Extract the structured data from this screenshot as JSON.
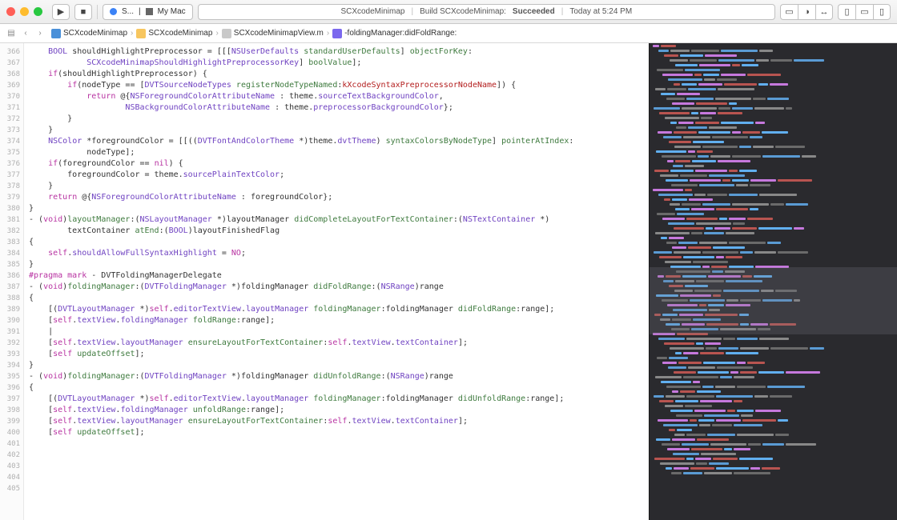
{
  "toolbar": {
    "scheme": "S...",
    "destination": "My Mac",
    "status_project": "SCXcodeMinimap",
    "status_action": "Build SCXcodeMinimap:",
    "status_result": "Succeeded",
    "status_time": "Today at 5:24 PM"
  },
  "jumpbar": {
    "segments": [
      {
        "icon": "proj",
        "label": "SCXcodeMinimap"
      },
      {
        "icon": "folder",
        "label": "SCXcodeMinimap"
      },
      {
        "icon": "file",
        "label": "SCXcodeMinimapView.m"
      },
      {
        "icon": "method",
        "label": "-foldingManager:didFoldRange:"
      }
    ]
  },
  "gutter": {
    "start": 366,
    "count": 40
  },
  "code_lines": [
    {
      "indent": 1,
      "tokens": [
        [
          "type",
          "BOOL"
        ],
        [
          "",
          " shouldHighlightPreprocessor = [[["
        ],
        [
          "type",
          "NSUserDefaults"
        ],
        [
          "",
          " "
        ],
        [
          "sel",
          "standardUserDefaults"
        ],
        [
          "",
          "] "
        ],
        [
          "sel",
          "objectForKey"
        ],
        [
          "",
          ":"
        ]
      ]
    },
    {
      "indent": 3,
      "tokens": [
        [
          "type",
          "SCXcodeMinimapShouldHighlightPreprocessorKey"
        ],
        [
          "",
          "] "
        ],
        [
          "sel",
          "boolValue"
        ],
        [
          "",
          "];"
        ]
      ]
    },
    {
      "indent": 1,
      "tokens": [
        [
          "kw",
          "if"
        ],
        [
          "",
          "(shouldHighlightPreprocessor) {"
        ]
      ]
    },
    {
      "indent": 2,
      "tokens": [
        [
          "kw",
          "if"
        ],
        [
          "",
          "(nodeType == ["
        ],
        [
          "type",
          "DVTSourceNodeTypes"
        ],
        [
          "",
          " "
        ],
        [
          "sel",
          "registerNodeTypeNamed"
        ],
        [
          "",
          ":"
        ],
        [
          "lit",
          "kXcodeSyntaxPreprocessorNodeName"
        ],
        [
          "",
          "]) {"
        ]
      ]
    },
    {
      "indent": 3,
      "tokens": [
        [
          "kw",
          "return"
        ],
        [
          "",
          " @{"
        ],
        [
          "type",
          "NSForegroundColorAttributeName"
        ],
        [
          "",
          " : theme."
        ],
        [
          "prop",
          "sourceTextBackgroundColor"
        ],
        [
          "",
          ","
        ]
      ]
    },
    {
      "indent": 5,
      "tokens": [
        [
          "type",
          "NSBackgroundColorAttributeName"
        ],
        [
          "",
          " : theme."
        ],
        [
          "prop",
          "preprocessorBackgroundColor"
        ],
        [
          "",
          "};"
        ]
      ]
    },
    {
      "indent": 2,
      "tokens": [
        [
          "",
          "}"
        ]
      ]
    },
    {
      "indent": 1,
      "tokens": [
        [
          "",
          "}"
        ]
      ]
    },
    {
      "indent": 0,
      "tokens": [
        [
          "",
          ""
        ]
      ]
    },
    {
      "indent": 1,
      "tokens": [
        [
          "type",
          "NSColor"
        ],
        [
          "",
          " *foregroundColor = [[(("
        ],
        [
          "type",
          "DVTFontAndColorTheme"
        ],
        [
          "",
          " *)theme."
        ],
        [
          "prop",
          "dvtTheme"
        ],
        [
          "",
          ") "
        ],
        [
          "sel",
          "syntaxColorsByNodeType"
        ],
        [
          "",
          "] "
        ],
        [
          "sel",
          "pointerAtIndex"
        ],
        [
          "",
          ":"
        ]
      ]
    },
    {
      "indent": 3,
      "tokens": [
        [
          "",
          "nodeType];"
        ]
      ]
    },
    {
      "indent": 1,
      "tokens": [
        [
          "kw",
          "if"
        ],
        [
          "",
          "(foregroundColor == "
        ],
        [
          "kw",
          "nil"
        ],
        [
          "",
          ") {"
        ]
      ]
    },
    {
      "indent": 2,
      "tokens": [
        [
          "",
          "foregroundColor = theme."
        ],
        [
          "prop",
          "sourcePlainTextColor"
        ],
        [
          "",
          ";"
        ]
      ]
    },
    {
      "indent": 1,
      "tokens": [
        [
          "",
          "}"
        ]
      ]
    },
    {
      "indent": 0,
      "tokens": [
        [
          "",
          ""
        ]
      ]
    },
    {
      "indent": 1,
      "tokens": [
        [
          "kw",
          "return"
        ],
        [
          "",
          " @{"
        ],
        [
          "type",
          "NSForegroundColorAttributeName"
        ],
        [
          "",
          " : foregroundColor};"
        ]
      ]
    },
    {
      "indent": 0,
      "tokens": [
        [
          "",
          "}"
        ]
      ]
    },
    {
      "indent": 0,
      "tokens": [
        [
          "",
          ""
        ]
      ]
    },
    {
      "indent": 0,
      "tokens": [
        [
          "",
          "- ("
        ],
        [
          "kw",
          "void"
        ],
        [
          "",
          ")"
        ],
        [
          "sel",
          "layoutManager"
        ],
        [
          "",
          ":("
        ],
        [
          "type",
          "NSLayoutManager"
        ],
        [
          "",
          " *)layoutManager "
        ],
        [
          "sel",
          "didCompleteLayoutForTextContainer"
        ],
        [
          "",
          ":("
        ],
        [
          "type",
          "NSTextContainer"
        ],
        [
          "",
          " *)"
        ]
      ]
    },
    {
      "indent": 2,
      "tokens": [
        [
          "",
          "textContainer "
        ],
        [
          "sel",
          "atEnd"
        ],
        [
          "",
          ":("
        ],
        [
          "type",
          "BOOL"
        ],
        [
          "",
          ")layoutFinishedFlag"
        ]
      ]
    },
    {
      "indent": 0,
      "tokens": [
        [
          "",
          "{"
        ]
      ]
    },
    {
      "indent": 1,
      "tokens": [
        [
          "kw",
          "self"
        ],
        [
          "",
          "."
        ],
        [
          "prop",
          "shouldAllowFullSyntaxHighlight"
        ],
        [
          "",
          " = "
        ],
        [
          "kw",
          "NO"
        ],
        [
          "",
          ";"
        ]
      ]
    },
    {
      "indent": 0,
      "tokens": [
        [
          "",
          "}"
        ]
      ]
    },
    {
      "indent": 0,
      "tokens": [
        [
          "",
          ""
        ]
      ]
    },
    {
      "indent": 0,
      "tokens": [
        [
          "kw",
          "#pragma mark"
        ],
        [
          "",
          " - DVTFoldingManagerDelegate"
        ]
      ]
    },
    {
      "indent": 0,
      "tokens": [
        [
          "",
          ""
        ]
      ]
    },
    {
      "indent": 0,
      "tokens": [
        [
          "",
          "- ("
        ],
        [
          "kw",
          "void"
        ],
        [
          "",
          ")"
        ],
        [
          "sel",
          "foldingManager"
        ],
        [
          "",
          ":("
        ],
        [
          "type",
          "DVTFoldingManager"
        ],
        [
          "",
          " *)foldingManager "
        ],
        [
          "sel",
          "didFoldRange"
        ],
        [
          "",
          ":("
        ],
        [
          "type",
          "NSRange"
        ],
        [
          "",
          ")range"
        ]
      ]
    },
    {
      "indent": 0,
      "tokens": [
        [
          "",
          "{"
        ]
      ]
    },
    {
      "indent": 1,
      "tokens": [
        [
          "",
          "[("
        ],
        [
          "type",
          "DVTLayoutManager"
        ],
        [
          "",
          " *)"
        ],
        [
          "kw",
          "self"
        ],
        [
          "",
          "."
        ],
        [
          "prop",
          "editorTextView"
        ],
        [
          "",
          "."
        ],
        [
          "prop",
          "layoutManager"
        ],
        [
          "",
          " "
        ],
        [
          "sel",
          "foldingManager"
        ],
        [
          "",
          ":foldingManager "
        ],
        [
          "sel",
          "didFoldRange"
        ],
        [
          "",
          ":range];"
        ]
      ]
    },
    {
      "indent": 0,
      "tokens": [
        [
          "",
          ""
        ]
      ]
    },
    {
      "indent": 1,
      "tokens": [
        [
          "",
          "["
        ],
        [
          "kw",
          "self"
        ],
        [
          "",
          "."
        ],
        [
          "prop",
          "textView"
        ],
        [
          "",
          "."
        ],
        [
          "prop",
          "foldingManager"
        ],
        [
          "",
          " "
        ],
        [
          "sel",
          "foldRange"
        ],
        [
          "",
          ":range];"
        ]
      ]
    },
    {
      "indent": 1,
      "tokens": [
        [
          "",
          "|"
        ]
      ]
    },
    {
      "indent": 1,
      "tokens": [
        [
          "",
          "["
        ],
        [
          "kw",
          "self"
        ],
        [
          "",
          "."
        ],
        [
          "prop",
          "textView"
        ],
        [
          "",
          "."
        ],
        [
          "prop",
          "layoutManager"
        ],
        [
          "",
          " "
        ],
        [
          "sel",
          "ensureLayoutForTextContainer"
        ],
        [
          "",
          ":"
        ],
        [
          "kw",
          "self"
        ],
        [
          "",
          "."
        ],
        [
          "prop",
          "textView"
        ],
        [
          "",
          "."
        ],
        [
          "prop",
          "textContainer"
        ],
        [
          "",
          "];"
        ]
      ]
    },
    {
      "indent": 1,
      "tokens": [
        [
          "",
          "["
        ],
        [
          "kw",
          "self"
        ],
        [
          "",
          " "
        ],
        [
          "sel",
          "updateOffset"
        ],
        [
          "",
          "];"
        ]
      ]
    },
    {
      "indent": 0,
      "tokens": [
        [
          "",
          "}"
        ]
      ]
    },
    {
      "indent": 0,
      "tokens": [
        [
          "",
          ""
        ]
      ]
    },
    {
      "indent": 0,
      "tokens": [
        [
          "",
          "- ("
        ],
        [
          "kw",
          "void"
        ],
        [
          "",
          ")"
        ],
        [
          "sel",
          "foldingManager"
        ],
        [
          "",
          ":("
        ],
        [
          "type",
          "DVTFoldingManager"
        ],
        [
          "",
          " *)foldingManager "
        ],
        [
          "sel",
          "didUnfoldRange"
        ],
        [
          "",
          ":("
        ],
        [
          "type",
          "NSRange"
        ],
        [
          "",
          ")range"
        ]
      ]
    },
    {
      "indent": 0,
      "tokens": [
        [
          "",
          "{"
        ]
      ]
    },
    {
      "indent": 1,
      "tokens": [
        [
          "",
          "[("
        ],
        [
          "type",
          "DVTLayoutManager"
        ],
        [
          "",
          " *)"
        ],
        [
          "kw",
          "self"
        ],
        [
          "",
          "."
        ],
        [
          "prop",
          "editorTextView"
        ],
        [
          "",
          "."
        ],
        [
          "prop",
          "layoutManager"
        ],
        [
          "",
          " "
        ],
        [
          "sel",
          "foldingManager"
        ],
        [
          "",
          ":foldingManager "
        ],
        [
          "sel",
          "didUnfoldRange"
        ],
        [
          "",
          ":range];"
        ]
      ]
    },
    {
      "indent": 0,
      "tokens": [
        [
          "",
          ""
        ]
      ]
    },
    {
      "indent": 1,
      "tokens": [
        [
          "",
          "["
        ],
        [
          "kw",
          "self"
        ],
        [
          "",
          "."
        ],
        [
          "prop",
          "textView"
        ],
        [
          "",
          "."
        ],
        [
          "prop",
          "foldingManager"
        ],
        [
          "",
          " "
        ],
        [
          "sel",
          "unfoldRange"
        ],
        [
          "",
          ":range];"
        ]
      ]
    },
    {
      "indent": 0,
      "tokens": [
        [
          "",
          ""
        ]
      ]
    },
    {
      "indent": 1,
      "tokens": [
        [
          "",
          "["
        ],
        [
          "kw",
          "self"
        ],
        [
          "",
          "."
        ],
        [
          "prop",
          "textView"
        ],
        [
          "",
          "."
        ],
        [
          "prop",
          "layoutManager"
        ],
        [
          "",
          " "
        ],
        [
          "sel",
          "ensureLayoutForTextContainer"
        ],
        [
          "",
          ":"
        ],
        [
          "kw",
          "self"
        ],
        [
          "",
          "."
        ],
        [
          "prop",
          "textView"
        ],
        [
          "",
          "."
        ],
        [
          "prop",
          "textContainer"
        ],
        [
          "",
          "];"
        ]
      ]
    },
    {
      "indent": 1,
      "tokens": [
        [
          "",
          "["
        ],
        [
          "kw",
          "self"
        ],
        [
          "",
          " "
        ],
        [
          "sel",
          "updateOffset"
        ],
        [
          "",
          "];"
        ]
      ]
    }
  ],
  "minimap": {
    "viewport": {
      "top_pct": 47,
      "height_pct": 14
    },
    "lines": 90
  }
}
